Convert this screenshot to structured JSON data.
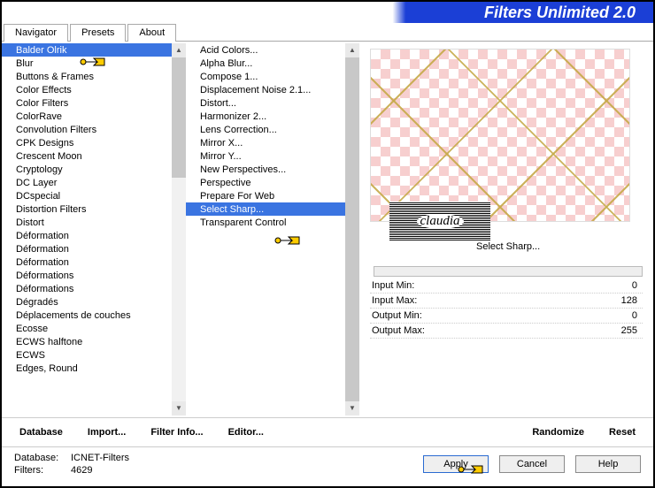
{
  "banner": {
    "title": "Filters Unlimited 2.0"
  },
  "tabs": [
    {
      "label": "Navigator",
      "active": true
    },
    {
      "label": "Presets",
      "active": false
    },
    {
      "label": "About",
      "active": false
    }
  ],
  "categories": {
    "items": [
      "Balder Olrik",
      "Blur",
      "Buttons & Frames",
      "Color Effects",
      "Color Filters",
      "ColorRave",
      "Convolution Filters",
      "CPK Designs",
      "Crescent Moon",
      "Cryptology",
      "DC Layer",
      "DCspecial",
      "Distortion Filters",
      "Distort",
      "Déformation",
      "Déformation",
      "Déformation",
      "Déformations",
      "Déformations",
      "Dégradés",
      "Déplacements de couches",
      "Ecosse",
      "ECWS halftone",
      "ECWS",
      "Edges, Round"
    ],
    "selected_index": 0
  },
  "filters": {
    "items": [
      "Acid Colors...",
      "Alpha Blur...",
      "Compose 1...",
      "Displacement Noise 2.1...",
      "Distort...",
      "Harmonizer 2...",
      "Lens Correction...",
      "Mirror X...",
      "Mirror Y...",
      "New Perspectives...",
      "Perspective",
      "Prepare For Web",
      "Select Sharp...",
      "Transparent Control"
    ],
    "selected_index": 12
  },
  "param_title": "Select Sharp...",
  "params": [
    {
      "label": "Input Min:",
      "value": "0"
    },
    {
      "label": "Input Max:",
      "value": "128"
    },
    {
      "label": "Output Min:",
      "value": "0"
    },
    {
      "label": "Output Max:",
      "value": "255"
    }
  ],
  "midbar": {
    "database": "Database",
    "import": "Import...",
    "filterinfo": "Filter Info...",
    "editor": "Editor...",
    "randomize": "Randomize",
    "reset": "Reset"
  },
  "meta": {
    "db_label": "Database:",
    "db_value": "ICNET-Filters",
    "filters_label": "Filters:",
    "filters_value": "4629"
  },
  "buttons": {
    "apply": "Apply",
    "cancel": "Cancel",
    "help": "Help"
  },
  "stamp": "claudia"
}
